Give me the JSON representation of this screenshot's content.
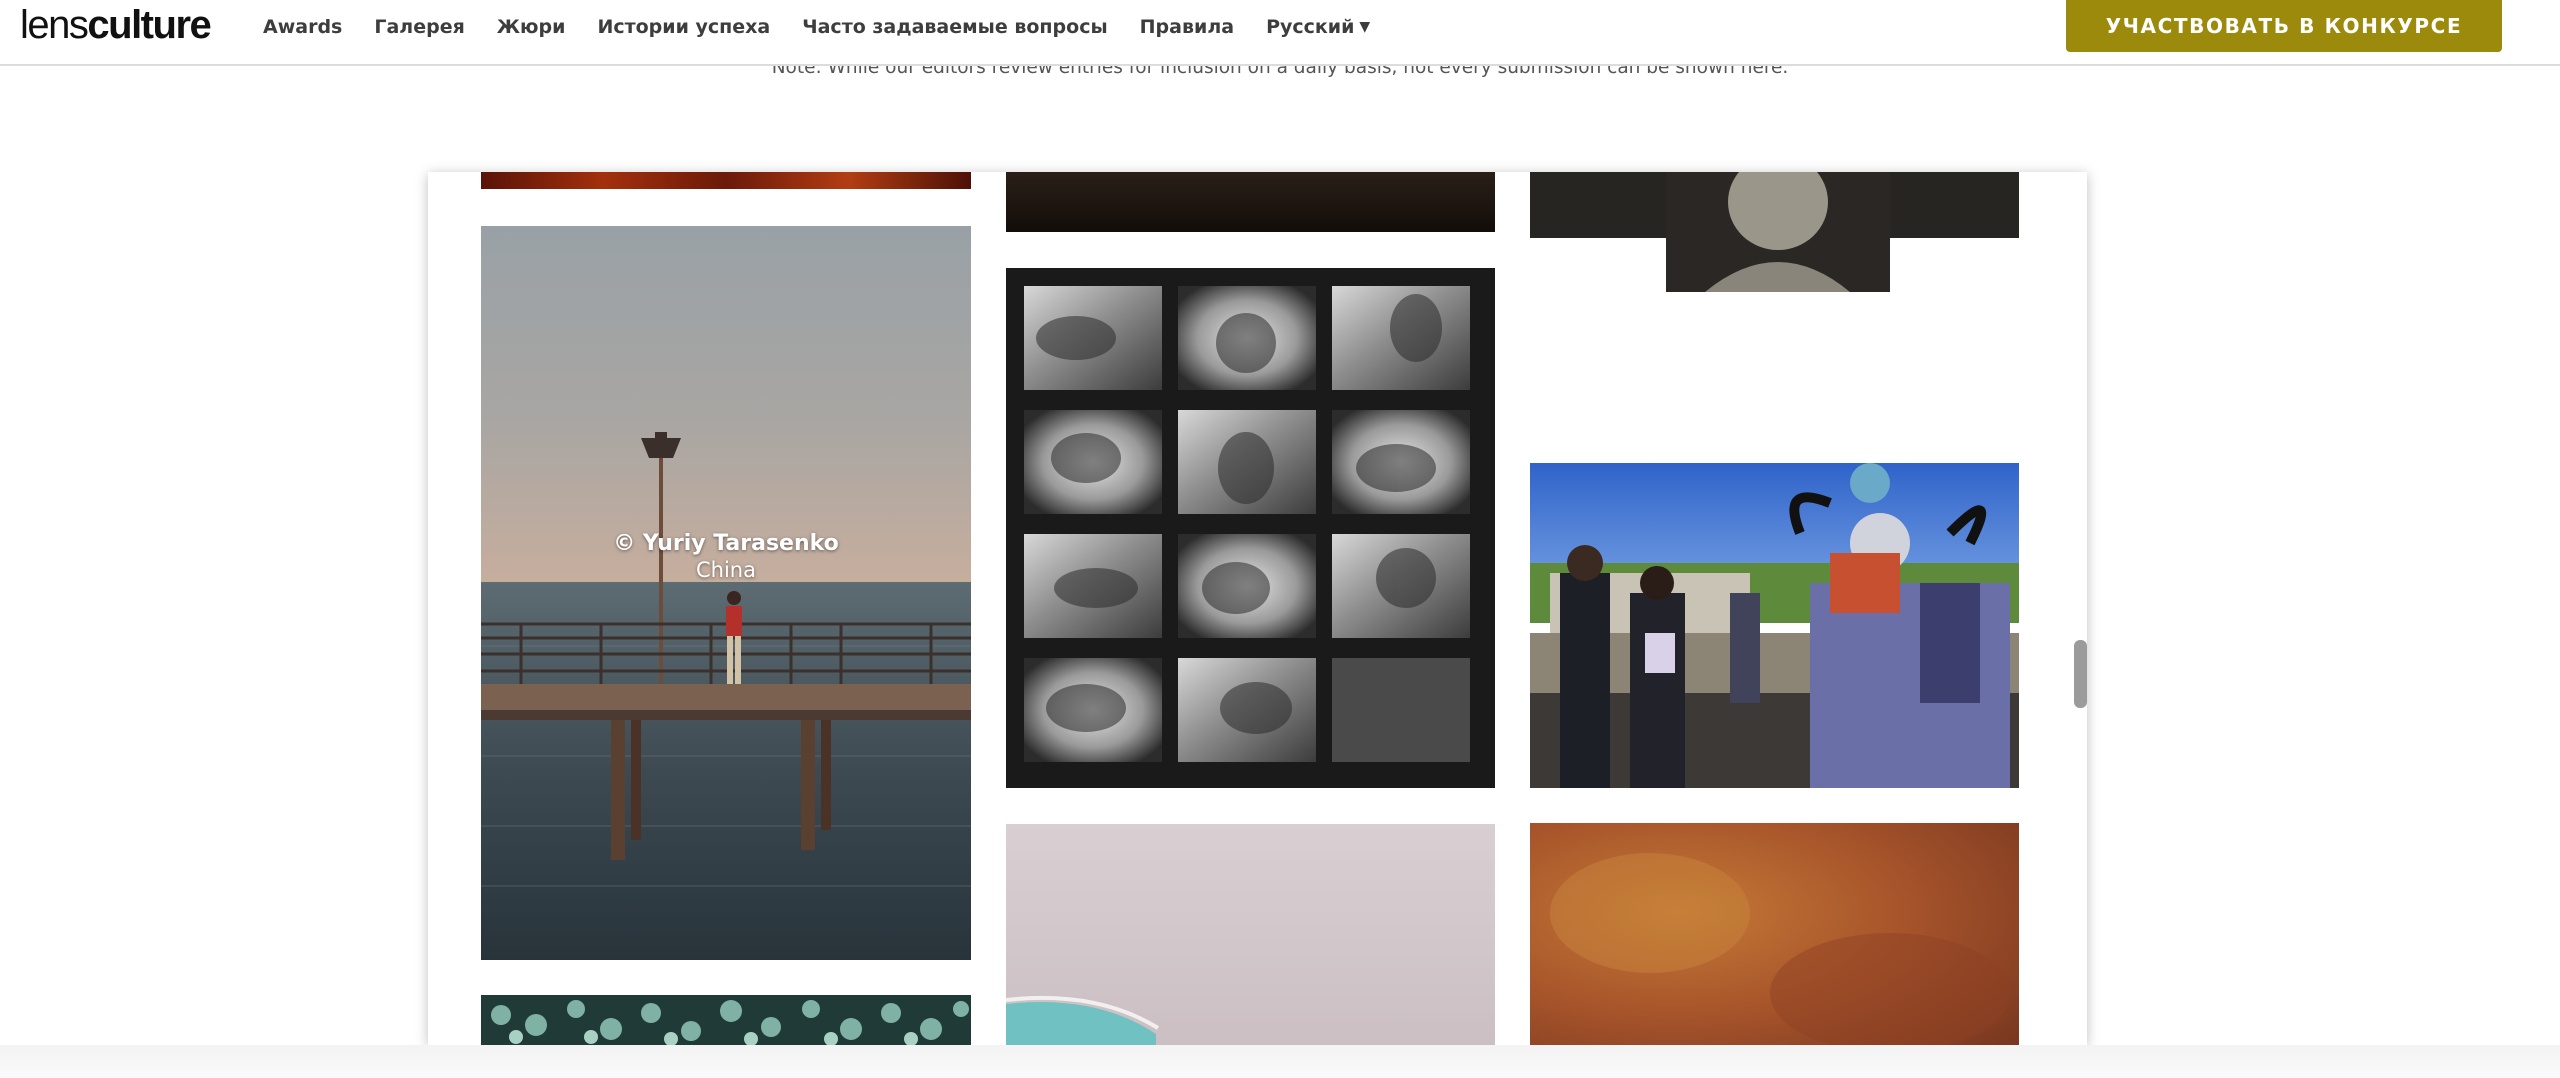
{
  "header": {
    "logo_light": "lens",
    "logo_bold": "culture",
    "nav": [
      "Awards",
      "Галерея",
      "Жюри",
      "Истории успеха",
      "Часто задаваемые вопросы",
      "Правила"
    ],
    "language": "Русский",
    "cta_label": "УЧАСТВОВАТЬ В КОНКУРСЕ"
  },
  "note": "Note: While our editors review entries for inclusion on a daily basis, not every submission can be shown here.",
  "gallery": {
    "featured_caption": {
      "author": "© Yuriy Tarasenko",
      "country": "China"
    }
  },
  "colors": {
    "accent": "#9c8a0d",
    "nav_text": "#3d3d3d"
  }
}
